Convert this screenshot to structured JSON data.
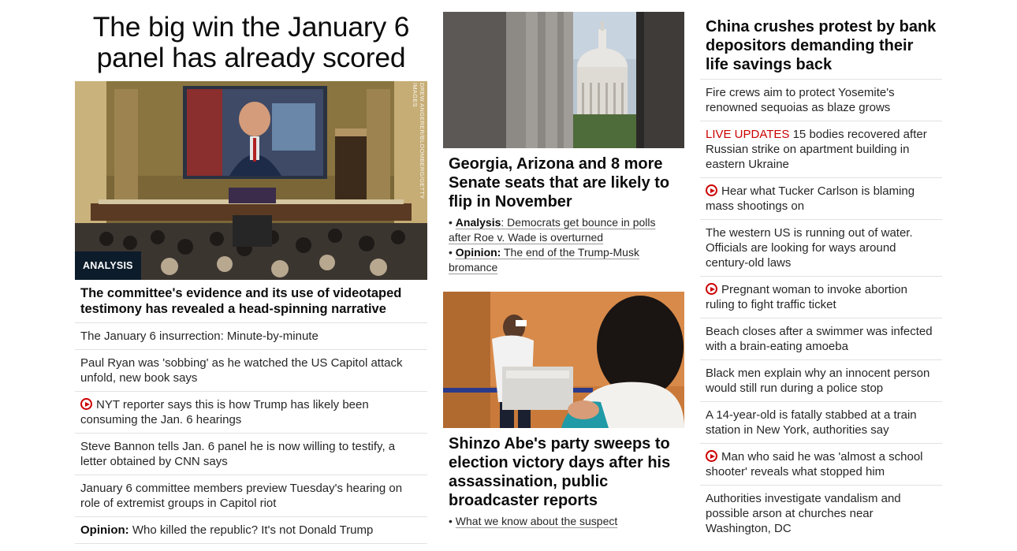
{
  "left": {
    "headline": "The big win the January 6 panel has already scored",
    "image_credit": "DREW ANGERER/BLOOMBERG/GETTY IMAGES",
    "analysis_label": "ANALYSIS",
    "caption": "The committee's evidence and its use of videotaped testimony has revealed a head-spinning narrative",
    "items": [
      {
        "text": "The January 6 insurrection: Minute-by-minute"
      },
      {
        "text": "Paul Ryan was 'sobbing' as he watched the US Capitol attack unfold, new book says"
      },
      {
        "text": "NYT reporter says this is how Trump has likely been consuming the Jan. 6 hearings"
      },
      {
        "text": "Steve Bannon tells Jan. 6 panel he is now willing to testify, a letter obtained by CNN says"
      },
      {
        "text": "January 6 committee members preview Tuesday's hearing on role of extremist groups in Capitol riot"
      },
      {
        "prefix": "Opinion:",
        "text": "Who killed the republic? It's not Donald Trump"
      }
    ]
  },
  "middle": {
    "card1": {
      "headline": "Georgia, Arizona and 8 more Senate seats that are likely to flip in November",
      "links": [
        {
          "bullet": "•",
          "prefix": "Analysis",
          "text": ": Democrats get bounce in polls after Roe v. Wade is overturned"
        },
        {
          "bullet": "•",
          "prefix": "Opinion:",
          "text": "The end of the Trump-Musk bromance"
        }
      ]
    },
    "card2": {
      "headline": "Shinzo Abe's party sweeps to election victory days after his assassination, public broadcaster reports",
      "links": [
        {
          "bullet": "•",
          "text": "What we know about the suspect"
        }
      ]
    }
  },
  "right": {
    "headline": "China crushes protest by bank depositors demanding their life savings back",
    "items": [
      {
        "text": "Fire crews aim to protect Yosemite's renowned sequoias as blaze grows"
      },
      {
        "live": "LIVE UPDATES",
        "text": "15 bodies recovered after Russian strike on apartment building in eastern Ukraine"
      },
      {
        "text": "Hear what Tucker Carlson is blaming mass shootings on"
      },
      {
        "text": "The western US is running out of water. Officials are looking for ways around century-old laws"
      },
      {
        "text": "Pregnant woman to invoke abortion ruling to fight traffic ticket"
      },
      {
        "text": "Beach closes after a swimmer was infected with a brain-eating amoeba"
      },
      {
        "text": "Black men explain why an innocent person would still run during a police stop"
      },
      {
        "text": "A 14-year-old is fatally stabbed at a train station in New York, authorities say"
      },
      {
        "text": "Man who said he was 'almost a school shooter' reveals what stopped him"
      },
      {
        "text": "Authorities investigate vandalism and possible arson at churches near Washington, DC"
      }
    ]
  },
  "colors": {
    "live": "#cc0000",
    "play_icon": "#cc0000",
    "divider": "#e2e2e2",
    "analysis_bg": "#0c1c2a"
  },
  "icons": {
    "video": "play-circle-icon"
  }
}
